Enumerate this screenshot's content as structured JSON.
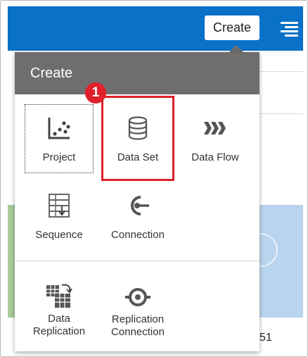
{
  "header": {
    "create_button": "Create"
  },
  "menu": {
    "title": "Create",
    "items": [
      {
        "label": "Project",
        "icon": "project-scatter-icon"
      },
      {
        "label": "Data Set",
        "icon": "database-icon"
      },
      {
        "label": "Data Flow",
        "icon": "data-flow-icon"
      },
      {
        "label": "Sequence",
        "icon": "sequence-icon"
      },
      {
        "label": "Connection",
        "icon": "connection-icon"
      },
      {
        "label_line1": "Data",
        "label_line2": "Replication",
        "icon": "data-replication-icon"
      },
      {
        "label_line1": "Replication",
        "label_line2": "Connection",
        "icon": "replication-connection-icon"
      }
    ]
  },
  "annotation": {
    "badge": "1",
    "color": "#e0202a"
  },
  "background": {
    "number_text": "51"
  },
  "colors": {
    "topbar": "#0a71c9",
    "menu_header": "#6e6e6e"
  }
}
